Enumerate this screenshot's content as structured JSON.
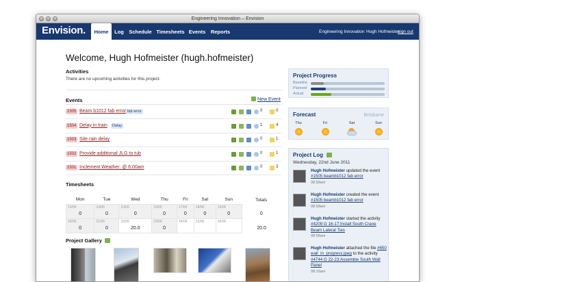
{
  "window": {
    "title": "Engineering Innovation – Envision"
  },
  "nav": {
    "logo": "Envision.",
    "items": [
      "Home",
      "Log",
      "Schedule",
      "Timesheets",
      "Events",
      "Reports"
    ],
    "active": "Home",
    "project": "Engineering Innovation",
    "user": "Hugh Hofmeister",
    "sign_out": "sign out"
  },
  "welcome": "Welcome, Hugh Hofmeister (hugh.hofmeister)",
  "activities": {
    "title": "Activities",
    "empty": "There are no upcoming activities for this project."
  },
  "events": {
    "title": "Events",
    "new_label": "New Event",
    "items": [
      {
        "id": "1505",
        "title": "Beam b1012 fab error",
        "tag": "fab error",
        "comments": "0",
        "docs": "0"
      },
      {
        "id": "1504",
        "title": "Delay in train",
        "tag": "Delay",
        "comments": "1",
        "docs": "4"
      },
      {
        "id": "1503",
        "title": "Site rain delay",
        "tag": "",
        "comments": "0",
        "docs": "1"
      },
      {
        "id": "1502",
        "title": "Provide additional JLG to tub",
        "tag": "",
        "comments": "0",
        "docs": "1"
      },
      {
        "id": "1501",
        "title": "Inclement Weather. @ 6.00am",
        "tag": "",
        "comments": "0",
        "docs": "3"
      }
    ]
  },
  "timesheets": {
    "title": "Timesheets",
    "headers": [
      "Mon",
      "Tue",
      "Wed",
      "Thu",
      "Fri",
      "Sat",
      "Sun",
      "Totals"
    ],
    "rows": [
      {
        "dates": [
          "13/06",
          "14/06",
          "15/06",
          "16/06",
          "17/06",
          "18/06",
          "19/06"
        ],
        "values": [
          "0",
          "0",
          "0",
          "0",
          "0",
          "0",
          "0"
        ],
        "total": "0"
      },
      {
        "dates": [
          "20/06",
          "21/06",
          "22/06",
          "23/06",
          "24/06",
          "25/06",
          "26/06"
        ],
        "values": [
          "0",
          "0",
          "20.0",
          "0",
          "",
          "",
          ""
        ],
        "total": "20.0"
      }
    ]
  },
  "gallery": {
    "title": "Project Gallery"
  },
  "progress": {
    "title": "Project Progress",
    "rows": [
      {
        "label": "Baseline",
        "value": 0.18,
        "color": "#8a8a8a"
      },
      {
        "label": "Planned",
        "value": 0.2,
        "color": "#1f3f7a"
      },
      {
        "label": "Actual",
        "value": 0.28,
        "color": "#6aa51a"
      }
    ]
  },
  "forecast": {
    "title": "Forecast",
    "city": "Brisbane",
    "days": [
      {
        "name": "Thu",
        "icon": "sun-icon"
      },
      {
        "name": "Fri",
        "icon": "sun-icon"
      },
      {
        "name": "Sat",
        "icon": "partly-cloudy-icon"
      },
      {
        "name": "Sun",
        "icon": "sun-icon"
      }
    ]
  },
  "log": {
    "title": "Project Log",
    "date": "Wednesday, 22nd June 2011",
    "entries": [
      {
        "user": "Hugh Hofmeister",
        "pre": "updated the event",
        "link": "#1505 beamb1012 fab error",
        "post": "",
        "time": "08:58am"
      },
      {
        "user": "Hugh Hofmeister",
        "pre": "created the event",
        "link": "#1505 beamb1012 fab error",
        "post": "",
        "time": "08:58am"
      },
      {
        "user": "Hugh Hofmeister",
        "pre": "started the activity",
        "link": "#4209 G 16-17:Install South Crane Beam Lateral Ties",
        "post": "",
        "time": "08:58am"
      },
      {
        "user": "Hugh Hofmeister",
        "pre": "attached the file",
        "link": "#650 wall_in_progress.jpeg",
        "post": "to the activity",
        "link2": "#4744 G 22-23:Assemble South Wall Panel",
        "time": "08:16am"
      }
    ]
  }
}
